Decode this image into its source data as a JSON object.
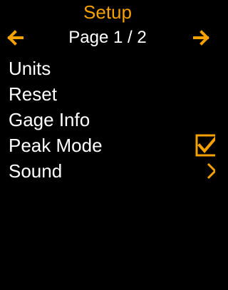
{
  "colors": {
    "background": "#000000",
    "accent": "#f5a100",
    "text": "#ffffff"
  },
  "header": {
    "title": "Setup"
  },
  "pager": {
    "label": "Page 1 / 2",
    "prev_icon": "arrow-left-icon",
    "next_icon": "arrow-right-icon"
  },
  "menu": {
    "items": [
      {
        "label": "Units",
        "control": "none"
      },
      {
        "label": "Reset",
        "control": "none"
      },
      {
        "label": "Gage Info",
        "control": "none"
      },
      {
        "label": "Peak Mode",
        "control": "checkbox",
        "checked": true
      },
      {
        "label": "Sound",
        "control": "chevron-right-icon"
      }
    ]
  }
}
